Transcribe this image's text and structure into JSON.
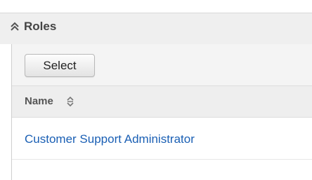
{
  "panel": {
    "title": "Roles",
    "collapse_icon": "chevron-double-up-icon"
  },
  "toolbar": {
    "select_label": "Select"
  },
  "table": {
    "columns": [
      {
        "label": "Name",
        "sort_icon": "sort-up-down-icon"
      }
    ],
    "rows": [
      {
        "name": "Customer Support Administrator"
      }
    ]
  },
  "colors": {
    "link": "#1a5fb4",
    "header_bg": "#efefef",
    "title_text": "#444444"
  }
}
